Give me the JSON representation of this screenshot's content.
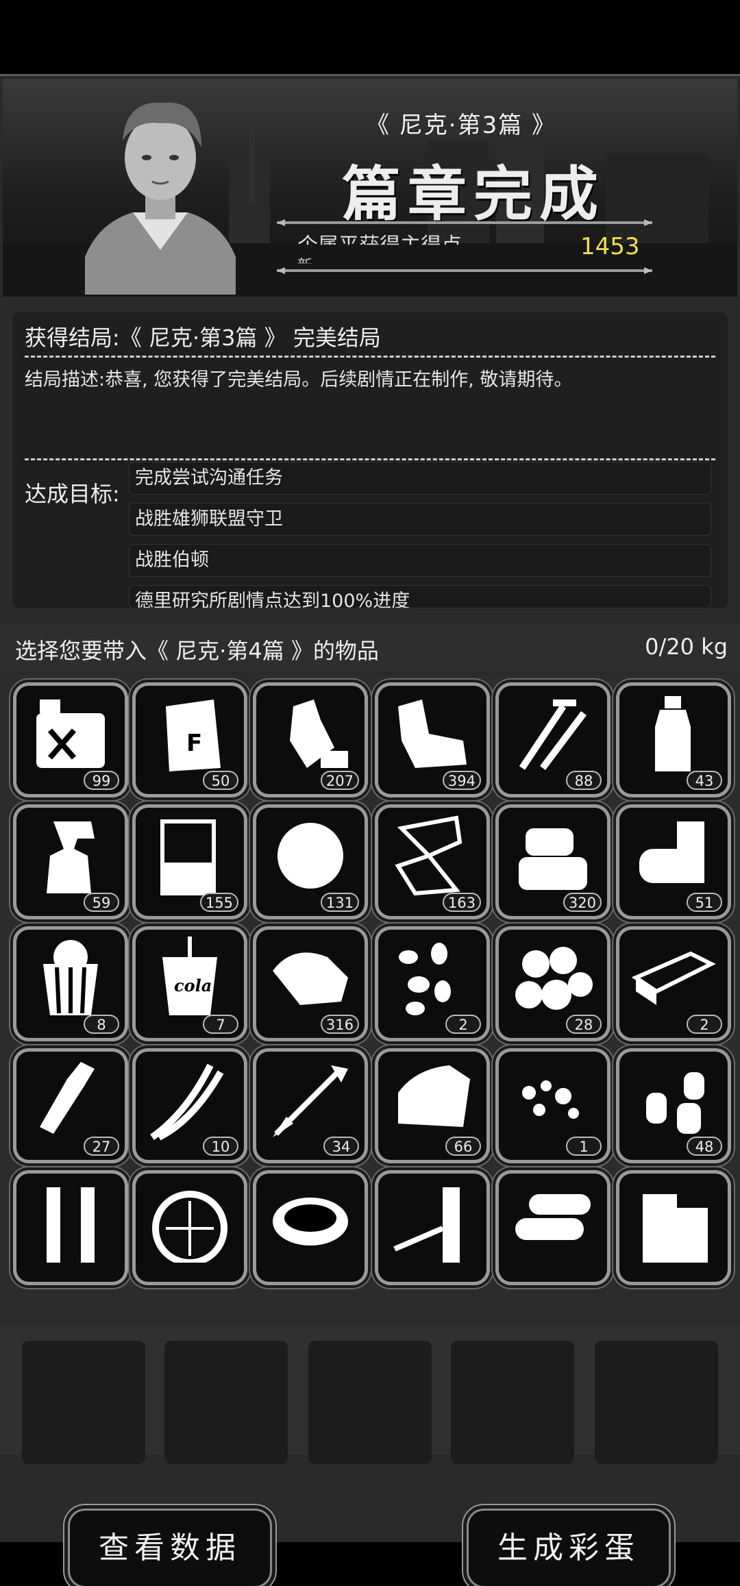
{
  "banner": {
    "subtitle": "《 尼克·第3篇 》",
    "title": "篇章完成",
    "bar_text": "个属平获得主得点",
    "bar_text2": "新",
    "score": "1453"
  },
  "ending": {
    "label": "获得结局:《 尼克·第3篇 》  完美结局",
    "desc": "结局描述:恭喜, 您获得了完美结局。后续剧情正在制作, 敬请期待。",
    "goal_label": "达成目标:",
    "goals": [
      "完成尝试沟通任务",
      "战胜雄狮联盟守卫",
      "战胜伯顿",
      "德里研究所剧情点达到100%进度"
    ]
  },
  "selector": {
    "label": "选择您要带入《 尼克·第4篇 》的物品",
    "weight": "0/20 kg"
  },
  "items": [
    {
      "icon": "fuel-can-icon",
      "count": "99"
    },
    {
      "icon": "flour-bag-icon",
      "count": "50"
    },
    {
      "icon": "crushed-bottle-icon",
      "count": "207"
    },
    {
      "icon": "cloth-rags-icon",
      "count": "394"
    },
    {
      "icon": "nails-icon",
      "count": "88"
    },
    {
      "icon": "water-bottle-icon",
      "count": "43"
    },
    {
      "icon": "spray-bottle-icon",
      "count": "59"
    },
    {
      "icon": "beaker-icon",
      "count": "155"
    },
    {
      "icon": "fiber-ball-icon",
      "count": "131"
    },
    {
      "icon": "glass-shards-icon",
      "count": "163"
    },
    {
      "icon": "folded-cloth-icon",
      "count": "320"
    },
    {
      "icon": "canned-food-icon",
      "count": "51"
    },
    {
      "icon": "popcorn-icon",
      "count": "8"
    },
    {
      "icon": "cola-cup-icon",
      "count": "7"
    },
    {
      "icon": "raw-meat-icon",
      "count": "316"
    },
    {
      "icon": "seeds-icon",
      "count": "2"
    },
    {
      "icon": "potatoes-icon",
      "count": "28"
    },
    {
      "icon": "wood-plank-icon",
      "count": "2"
    },
    {
      "icon": "milk-bottle-icon",
      "count": "27"
    },
    {
      "icon": "green-onion-icon",
      "count": "10"
    },
    {
      "icon": "arrow-icon",
      "count": "34"
    },
    {
      "icon": "leather-icon",
      "count": "66"
    },
    {
      "icon": "rubble-icon",
      "count": "1"
    },
    {
      "icon": "bullets-icon",
      "count": "48"
    },
    {
      "icon": "test-tubes-icon",
      "count": ""
    },
    {
      "icon": "sieve-icon",
      "count": ""
    },
    {
      "icon": "pot-icon",
      "count": ""
    },
    {
      "icon": "battery-icon",
      "count": ""
    },
    {
      "icon": "logs-icon",
      "count": ""
    },
    {
      "icon": "wood-blocks-icon",
      "count": ""
    }
  ],
  "buttons": {
    "view_data": "查看数据",
    "gen_egg": "生成彩蛋"
  }
}
